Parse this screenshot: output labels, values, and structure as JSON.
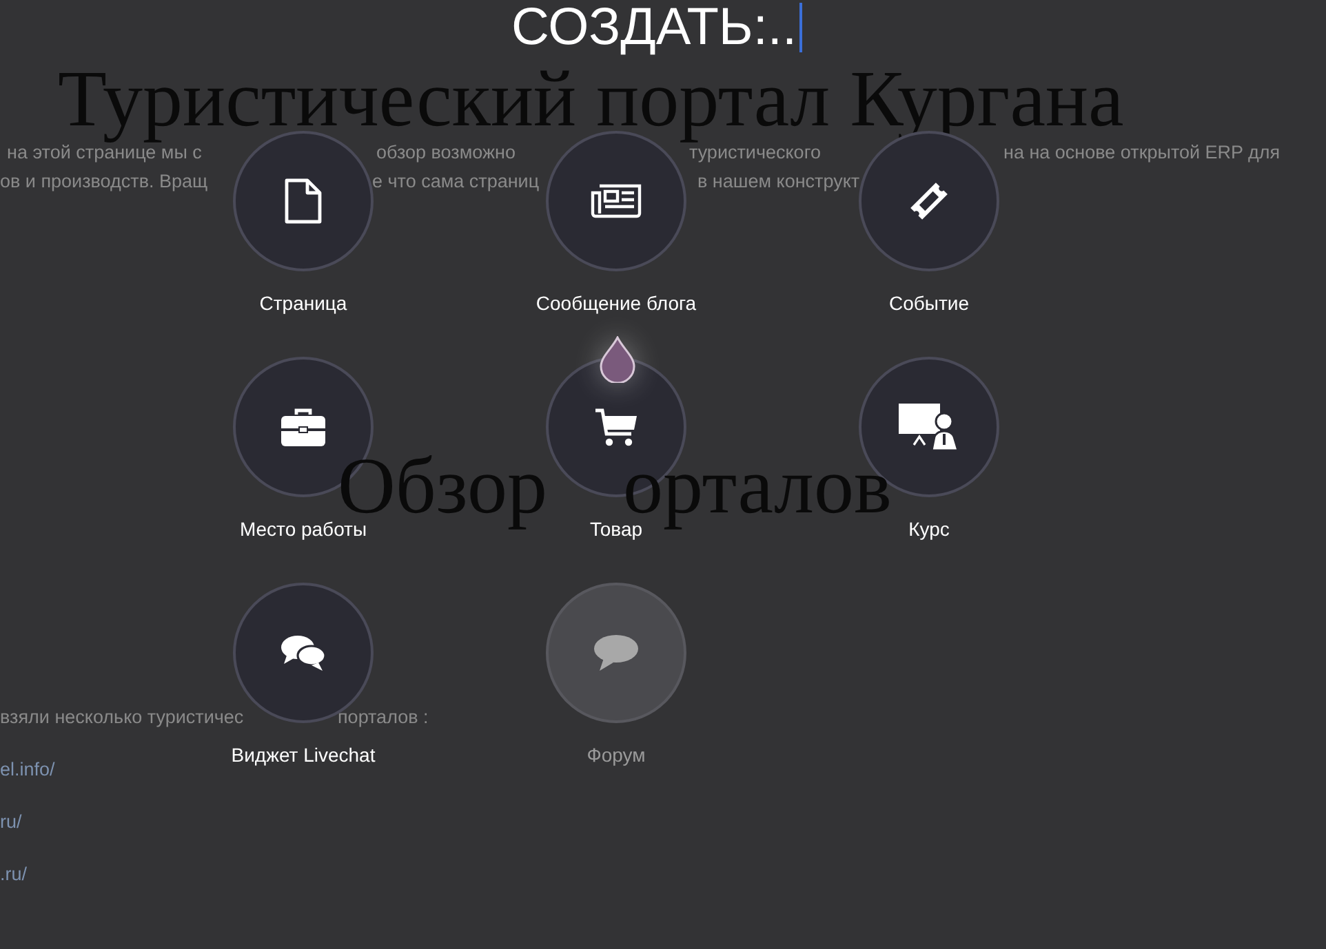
{
  "page": {
    "heading": "Туристический портал Кургана",
    "intro_lines": [
      [
        "на этой странице мы с",
        "обзор возможно",
        "туристического",
        "на на основе открытой ERP для"
      ],
      [
        "ов и производств. Вращ",
        "е что сама страниц",
        "в нашем конструкт"
      ]
    ],
    "section_heading": [
      "Обзор",
      "орталов"
    ],
    "section_text": [
      "взяли несколько туристичес",
      "порталов :"
    ],
    "links": [
      "el.info/",
      "ru/",
      ".ru/"
    ]
  },
  "create_menu": {
    "title": "СОЗДАТЬ:..",
    "items": [
      {
        "label": "Страница",
        "disabled": false
      },
      {
        "label": "Сообщение блога",
        "disabled": false
      },
      {
        "label": "Событие",
        "disabled": false
      },
      {
        "label": "Место работы",
        "disabled": false
      },
      {
        "label": "Товар",
        "disabled": false
      },
      {
        "label": "Курс",
        "disabled": false
      },
      {
        "label": "Виджет Livechat",
        "disabled": false
      },
      {
        "label": "Форум",
        "disabled": true
      }
    ]
  }
}
